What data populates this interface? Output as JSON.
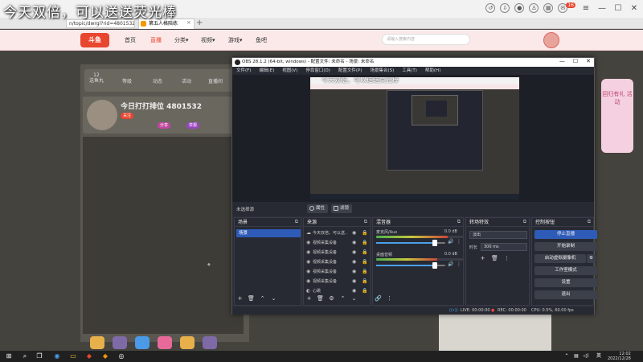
{
  "overlay": {
    "text": "今天双倍，可以送送荧光棒"
  },
  "browser": {
    "url": "n/topic/dwrgl?rid=4801532",
    "tab_title": "第五人格陪练",
    "tab_close": "×",
    "new_tab": "+",
    "notification_count": "16"
  },
  "site_nav": {
    "logo": "斗鱼",
    "items": [
      "首页",
      "直播",
      "分类▾",
      "视频▾",
      "游戏▾",
      "鱼吧"
    ],
    "search_placeholder": "请输入搜索内容"
  },
  "room": {
    "stats": [
      "12\n送鱼丸",
      "等级",
      "动态",
      "活动",
      "直播间"
    ],
    "title": "今日打打排位 4801532",
    "chips": [
      "关注",
      "分享",
      "举报"
    ],
    "promo": "回归有礼 活动"
  },
  "obs": {
    "title": "OBS 28.1.2 (64-bit, windows) - 配置文件: 未命名 - 场景: 未命名",
    "win_buttons": [
      "—",
      "☐",
      "✕"
    ],
    "menu": [
      "文件(F)",
      "编辑(E)",
      "视图(V)",
      "停靠窗口(D)",
      "配置文件(P)",
      "场景集合(S)",
      "工具(T)",
      "帮助(H)"
    ],
    "preview_title": "今天双倍，可以送送荧光棒",
    "no_source": "未选择源",
    "props_label": "属性",
    "filters_label": "滤镜",
    "docks": {
      "scenes": {
        "title": "场景",
        "items": [
          "场景"
        ]
      },
      "sources": {
        "title": "来源",
        "items": [
          "今天双倍，可以送..",
          "视频采集设备",
          "视频采集设备",
          "视频采集设备",
          "视频采集设备",
          "视频采集设备",
          "心跳"
        ]
      },
      "mixer": {
        "title": "混音器",
        "channels": [
          {
            "name": "麦克风/Aux",
            "db": "0.0 dB",
            "level": 0.82,
            "volume": 0.85
          },
          {
            "name": "桌面音频",
            "db": "0.0 dB",
            "level": 0.7,
            "volume": 0.85
          }
        ]
      },
      "transitions": {
        "title": "转场特效",
        "type": "淡出",
        "duration_label": "时长",
        "duration": "300 ms"
      },
      "controls": {
        "title": "控制按钮",
        "buttons": [
          "停止直播",
          "开始录制",
          "启动虚拟摄像机",
          "工作室模式",
          "设置",
          "退出"
        ]
      }
    },
    "status": {
      "live": "LIVE: 00:00:00",
      "rec": "REC: 00:00:00",
      "cpu": "CPU: 0.5%, 60.00 fps"
    }
  },
  "taskbar": {
    "time": "12:02",
    "date": "2022/12/28"
  },
  "colors": {
    "accent": "#2f5bb8",
    "site_red": "#e8462e"
  }
}
